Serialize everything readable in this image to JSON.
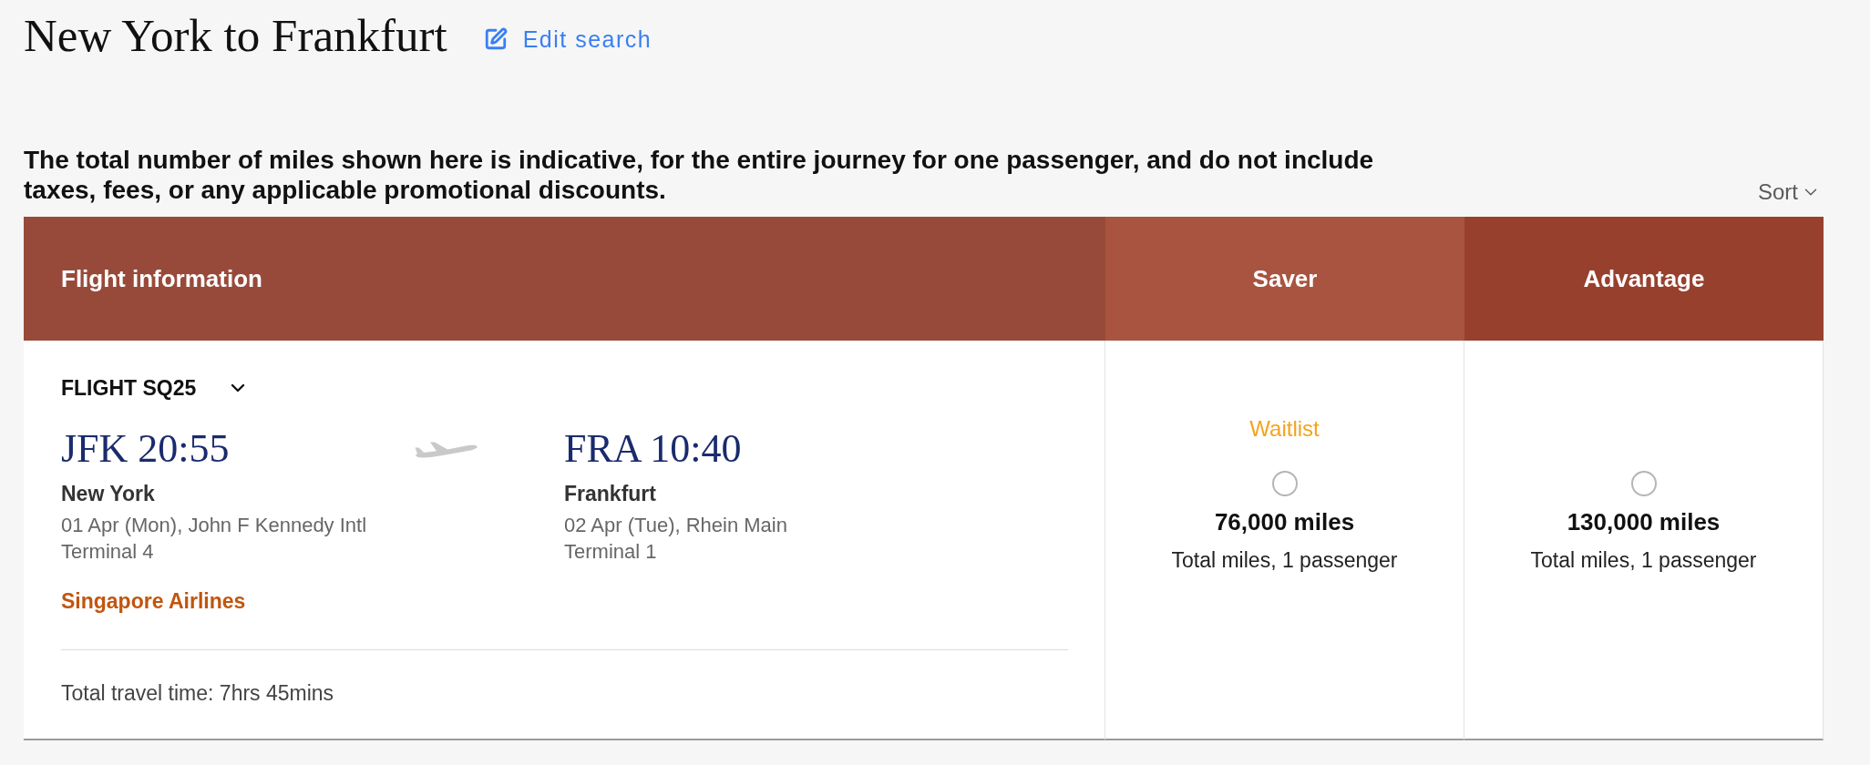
{
  "page": {
    "title": "New York to Frankfurt",
    "edit_link": "Edit search"
  },
  "notice": "The total number of miles shown here is indicative, for the entire journey for one passenger, and do not include taxes, fees, or any applicable promotional discounts.",
  "sort": {
    "label": "Sort"
  },
  "table": {
    "columns": [
      {
        "label": "Flight information",
        "kind": "details",
        "color": "#984a3a"
      },
      {
        "label": "Saver",
        "kind": "fare",
        "color": "#a85440"
      },
      {
        "label": "Advantage",
        "kind": "fare",
        "color": "#98402e"
      }
    ],
    "rows": [
      {
        "flight": "FLIGHT SQ25",
        "expanded": false,
        "departure": {
          "code_time": "JFK 20:55",
          "city": "New York",
          "date_airport": "01 Apr (Mon), John F Kennedy Intl",
          "terminal": "Terminal 4"
        },
        "arrival": {
          "code_time": "FRA 10:40",
          "city": "Frankfurt",
          "date_airport": "02 Apr (Tue), Rhein Main",
          "terminal": "Terminal 1"
        },
        "airline": "Singapore Airlines",
        "travel_time": "Total travel time: 7hrs 45mins",
        "fares": [
          {
            "status": "Waitlist",
            "selected": false,
            "miles": "76,000 miles",
            "note": "Total miles, 1 passenger"
          },
          {
            "selected": false,
            "miles": "130,000 miles",
            "note": "Total miles, 1 passenger"
          }
        ]
      }
    ]
  }
}
